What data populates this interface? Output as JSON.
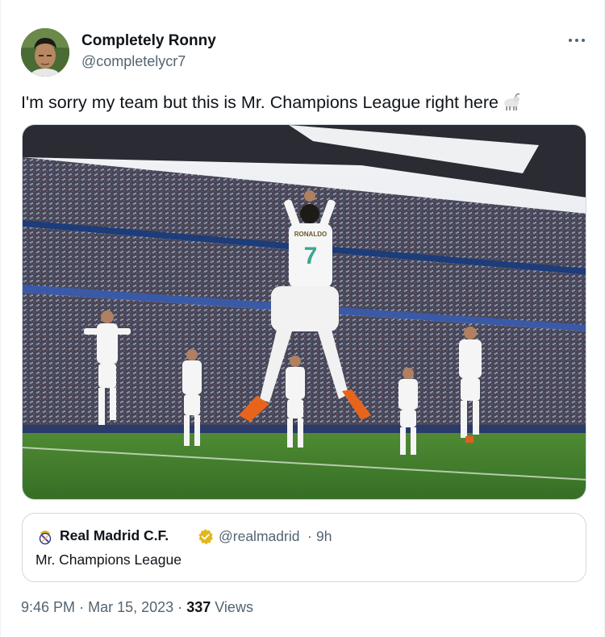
{
  "tweet": {
    "author": {
      "display_name": "Completely Ronny",
      "handle": "@completelycr7",
      "avatar_icon": "profile-photo"
    },
    "more_icon": "more-horizontal-icon",
    "text": "I'm sorry my team but this is Mr. Champions League right here",
    "emoji_icon": "goat-emoji",
    "media": {
      "description_icon": "stadium-celebration-photo",
      "jersey_name": "RONALDO",
      "jersey_number": "7"
    },
    "quote": {
      "logo_icon": "real-madrid-crest",
      "name": "Real Madrid C.F.",
      "verified_icon": "gold-verified-badge",
      "handle": "@realmadrid",
      "separator": "·",
      "time": "9h",
      "text": "Mr. Champions League"
    },
    "meta": {
      "time": "9:46 PM",
      "dot": "·",
      "date": "Mar 15, 2023",
      "views_count": "337",
      "views_label": "Views"
    }
  },
  "colors": {
    "text_primary": "#0f1419",
    "text_secondary": "#536471",
    "border": "#cfd9de",
    "verified_gold": "#e2b719",
    "pitch": "#3f7a2c"
  }
}
